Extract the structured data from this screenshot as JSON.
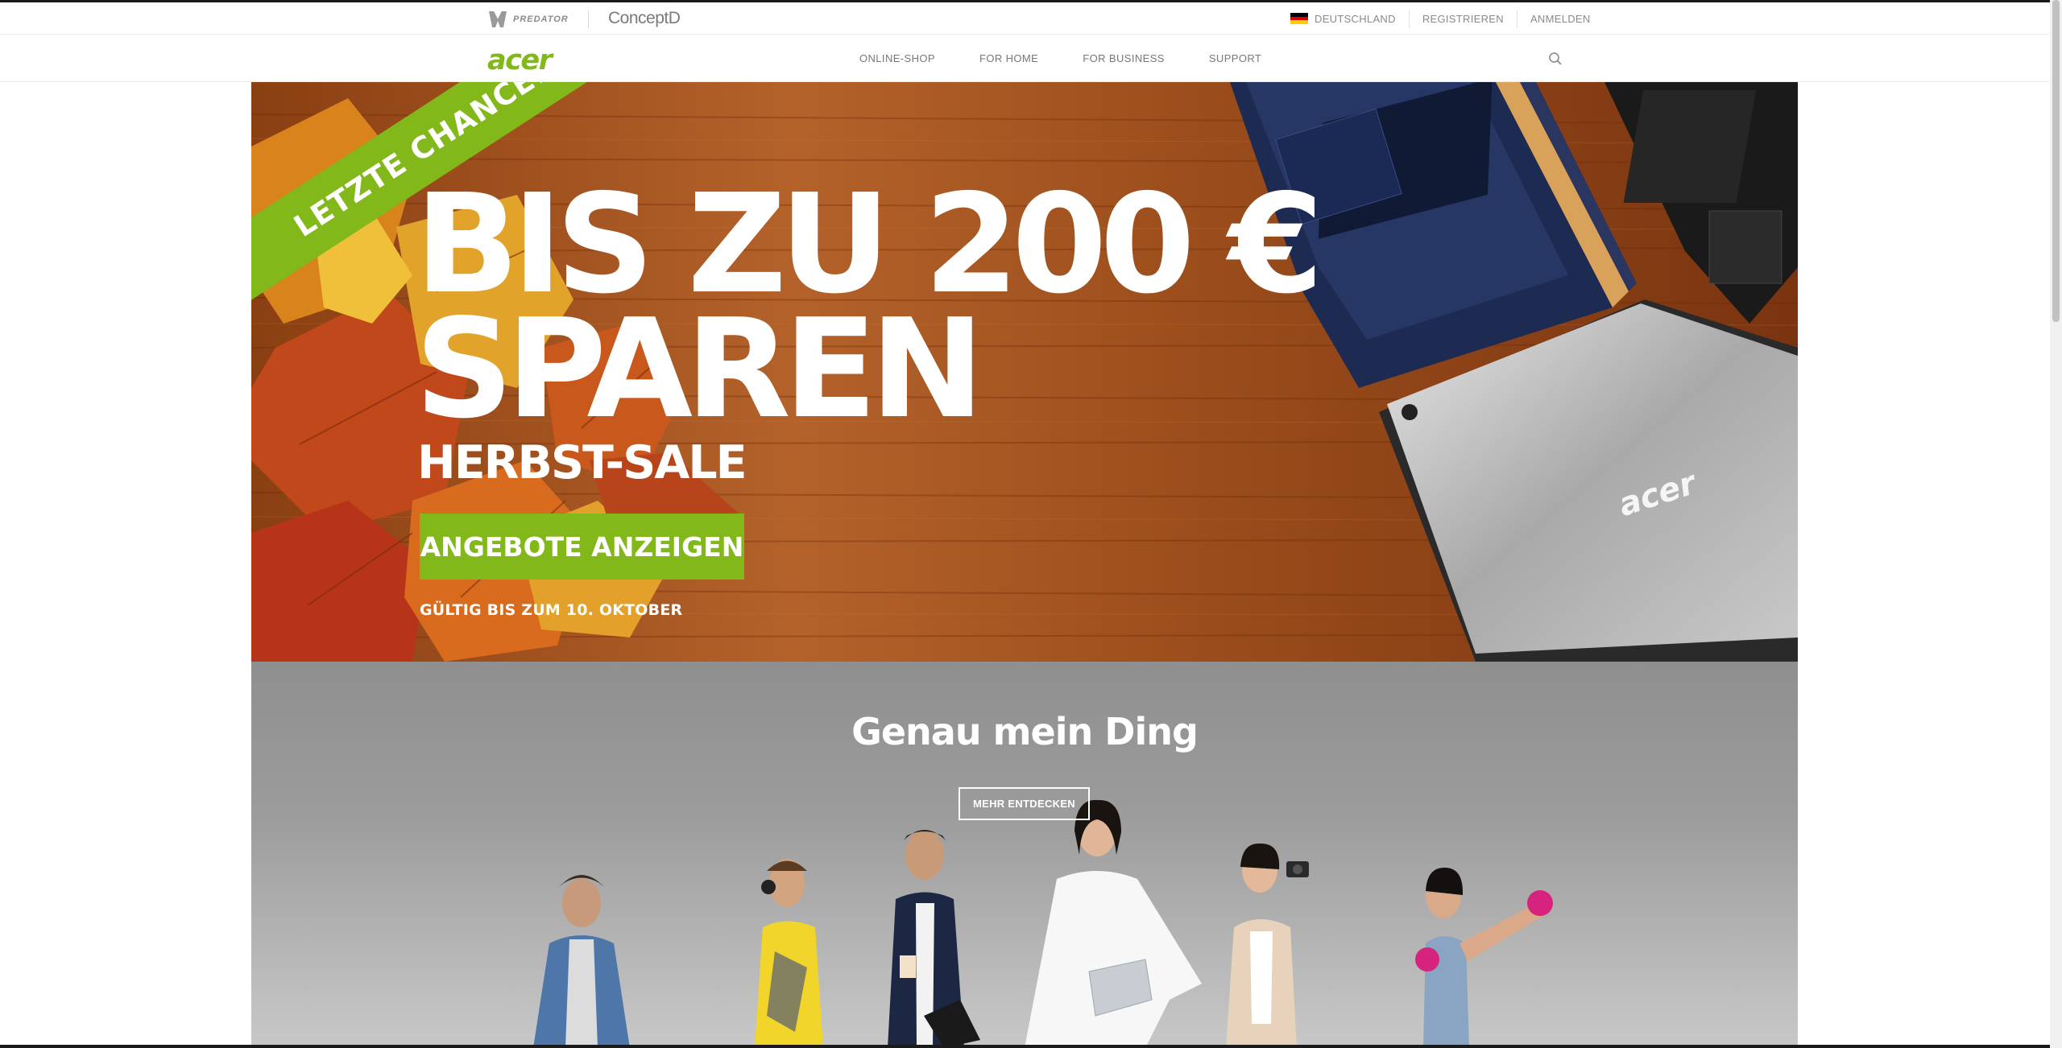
{
  "topbar": {
    "predator_label": "PREDATOR",
    "concept_label": "ConceptD",
    "country": "DEUTSCHLAND",
    "register": "REGISTRIEREN",
    "login": "ANMELDEN"
  },
  "nav": {
    "logo": "acer",
    "links": [
      "ONLINE-SHOP",
      "FOR HOME",
      "FOR BUSINESS",
      "SUPPORT"
    ],
    "search_icon": "search-icon"
  },
  "hero": {
    "ribbon": "LETZTE CHANCE!",
    "headline_line1": "BIS ZU 200 €",
    "headline_line2": "SPAREN",
    "subheadline": "HERBST-SALE",
    "cta": "ANGEBOTE ANZEIGEN",
    "note": "GÜLTIG BIS ZUM 10. OKTOBER",
    "laptop_brand": "acer"
  },
  "banner2": {
    "title": "Genau mein Ding",
    "button": "MEHR ENTDECKEN"
  },
  "colors": {
    "brand_green": "#83b81a",
    "wood": "#a0521f",
    "text_grey": "#8a8a8a"
  }
}
